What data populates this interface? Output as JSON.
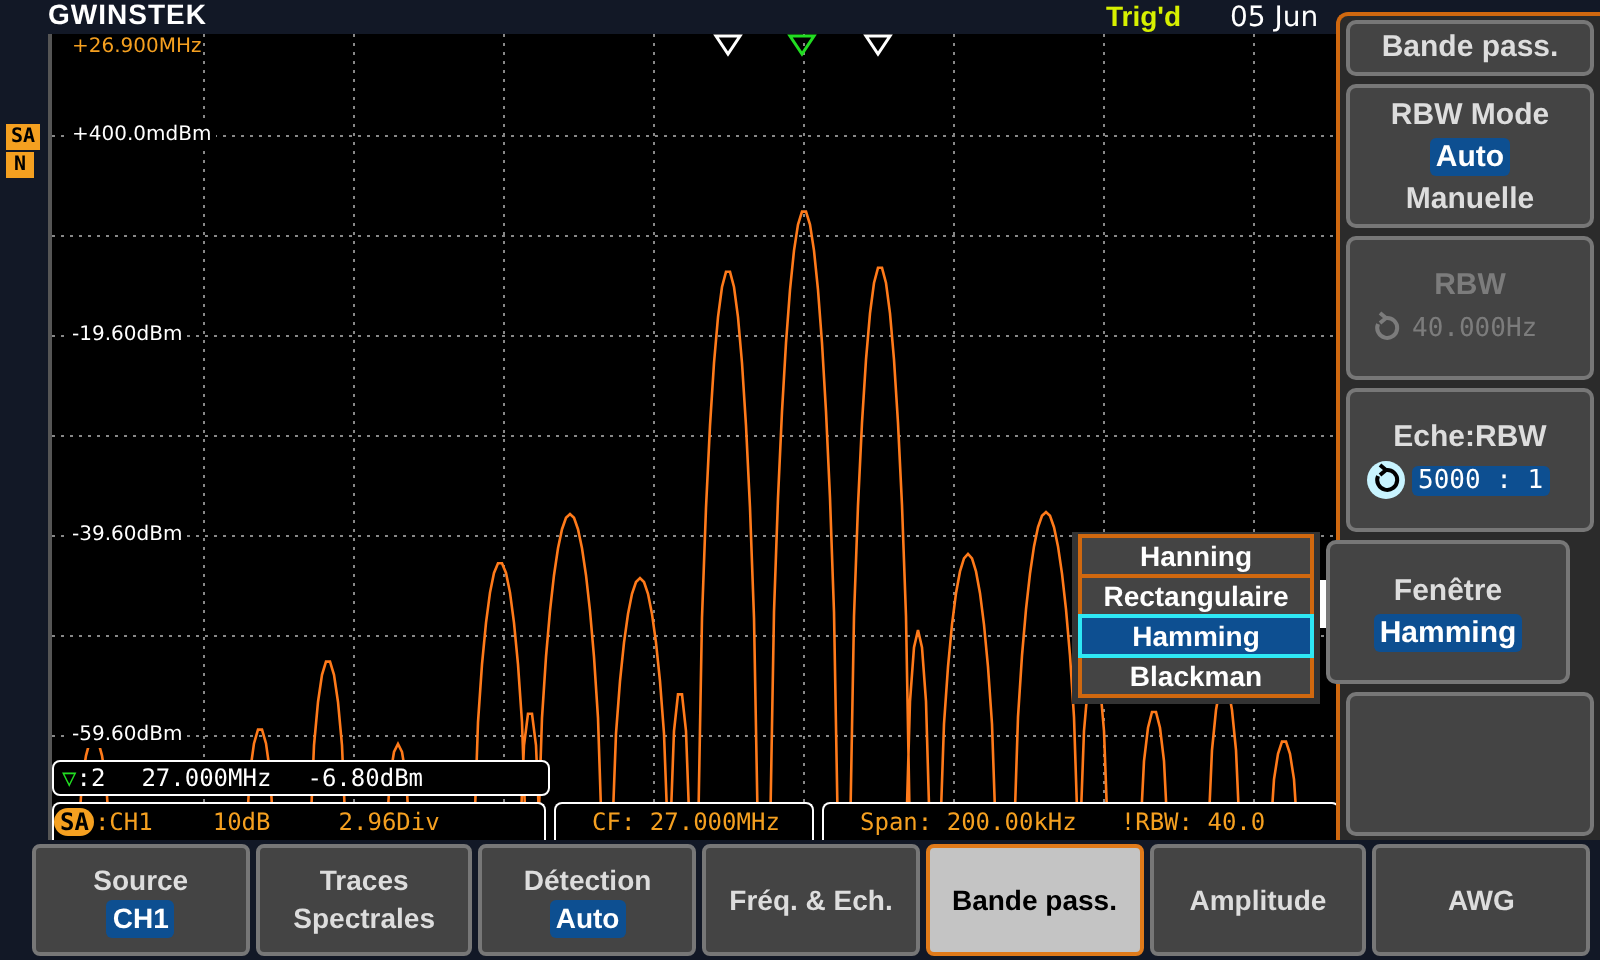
{
  "brand": "GWINSTEK",
  "status": {
    "trigger": "Trig'd",
    "date": "05 Jun"
  },
  "channel_tag": {
    "label": "SA",
    "sub": "N"
  },
  "plot": {
    "freq_label": "+26.900MHz",
    "y_labels": [
      "+400.0mdBm",
      "-19.60dBm",
      "-39.60dBm",
      "-59.60dBm"
    ],
    "markers": [
      {
        "selected": false
      },
      {
        "selected": true
      },
      {
        "selected": false
      }
    ]
  },
  "marker_readout": {
    "symbol": "▽",
    "index": ":2",
    "frequency": "27.000MHz",
    "level": "-6.80dBm"
  },
  "info_bar": {
    "tag": "SA",
    "channel": ":CH1",
    "scale": "10dB",
    "position": "2.96Div",
    "center": "CF: 27.000MHz",
    "span": "Span: 200.00kHz",
    "rbw": "!RBW: 40.0"
  },
  "window_popup": {
    "options": [
      {
        "label": "Hanning",
        "selected": false
      },
      {
        "label": "Rectangulaire",
        "selected": false
      },
      {
        "label": "Hamming",
        "selected": true
      },
      {
        "label": "Blackman",
        "selected": false
      }
    ]
  },
  "side_menu": {
    "title": "Bande pass.",
    "items": [
      {
        "kind": "options",
        "label": "RBW Mode",
        "options": [
          {
            "label": "Auto",
            "selected": true
          },
          {
            "label": "Manuelle",
            "selected": false
          }
        ]
      },
      {
        "kind": "value",
        "label": "RBW",
        "value": "40.000Hz",
        "disabled": true,
        "knob": true,
        "expanded": false
      },
      {
        "kind": "value",
        "label": "Eche:RBW",
        "value": "5000 : 1",
        "disabled": false,
        "knob": true,
        "expanded": false
      },
      {
        "kind": "value",
        "label": "Fenêtre",
        "value": "Hamming",
        "disabled": false,
        "knob": false,
        "expanded": true
      },
      {
        "kind": "empty"
      }
    ]
  },
  "softkeys": [
    {
      "label": "Source",
      "value": "CH1",
      "selected": false
    },
    {
      "label": "Traces Spectrales",
      "selected": false
    },
    {
      "label": "Détection",
      "value": "Auto",
      "selected": false
    },
    {
      "label": "Fréq. & Ech.",
      "selected": false
    },
    {
      "label": "Bande pass.",
      "selected": true
    },
    {
      "label": "Amplitude",
      "selected": false
    },
    {
      "label": "AWG",
      "selected": false
    }
  ]
}
